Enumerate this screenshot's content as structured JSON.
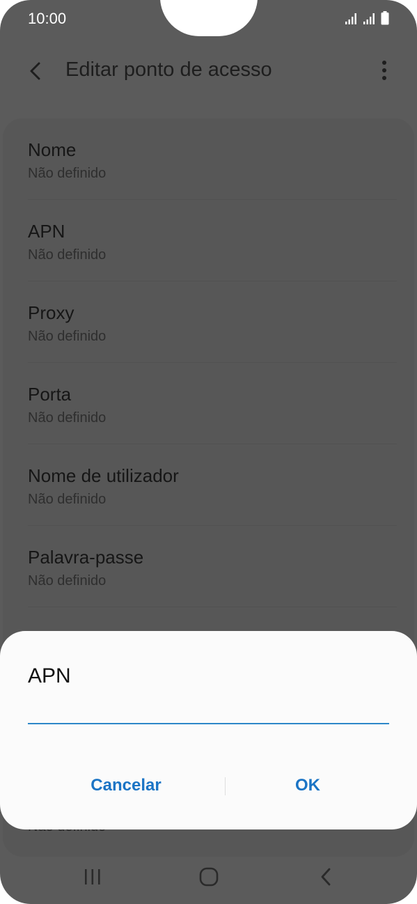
{
  "status_bar": {
    "time": "10:00"
  },
  "header": {
    "title": "Editar ponto de acesso",
    "back_icon": "chevron-left-icon",
    "more_icon": "more-vertical-icon"
  },
  "settings": {
    "items": [
      {
        "title": "Nome",
        "value": "Não definido"
      },
      {
        "title": "APN",
        "value": "Não definido"
      },
      {
        "title": "Proxy",
        "value": "Não definido"
      },
      {
        "title": "Porta",
        "value": "Não definido"
      },
      {
        "title": "Nome de utilizador",
        "value": "Não definido"
      },
      {
        "title": "Palavra-passe",
        "value": "Não definido"
      }
    ],
    "partial_item_value": "Não definido"
  },
  "dialog": {
    "title": "APN",
    "input_value": "",
    "cancel_label": "Cancelar",
    "ok_label": "OK"
  },
  "colors": {
    "accent": "#1b74c5",
    "input_underline": "#2d87c8",
    "overlay": "#5b5b5b"
  }
}
